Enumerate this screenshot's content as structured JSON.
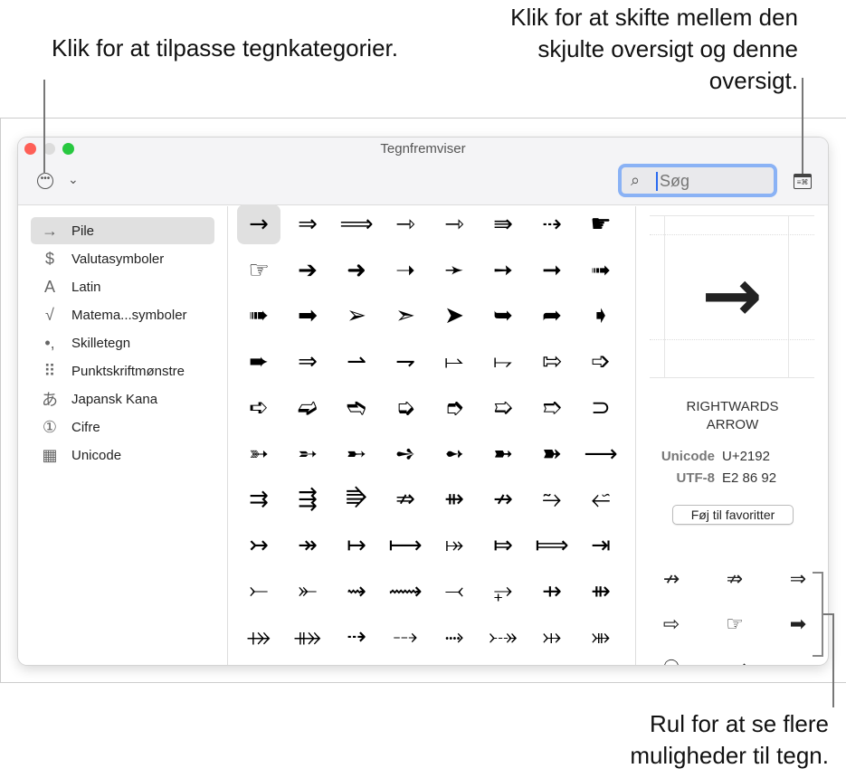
{
  "callouts": {
    "customize": "Klik for at tilpasse tegnkategorier.",
    "toggle": "Klik for at skifte mellem den skjulte oversigt og denne oversigt.",
    "scroll": "Rul for at se flere muligheder til tegn."
  },
  "window": {
    "title": "Tegnfremviser"
  },
  "toolbar": {
    "search_placeholder": "Søg",
    "search_value": ""
  },
  "sidebar": {
    "items": [
      {
        "icon": "→",
        "label": "Pile"
      },
      {
        "icon": "$",
        "label": "Valutasymboler"
      },
      {
        "icon": "A",
        "label": "Latin"
      },
      {
        "icon": "√",
        "label": "Matema...symboler"
      },
      {
        "icon": "•,",
        "label": "Skilletegn"
      },
      {
        "icon": "⠿",
        "label": "Punktskriftmønstre"
      },
      {
        "icon": "あ",
        "label": "Japansk Kana"
      },
      {
        "icon": "①",
        "label": "Cifre"
      },
      {
        "icon": "▦",
        "label": "Unicode"
      }
    ]
  },
  "grid": {
    "rows": [
      [
        "→",
        "⇒",
        "⟹",
        "⇾",
        "⇾",
        "⇛",
        "⇢",
        "☛"
      ],
      [
        "☞",
        "➔",
        "➜",
        "➝",
        "➛",
        "➙",
        "➞",
        "➟"
      ],
      [
        "➠",
        "➡",
        "➢",
        "➣",
        "➤",
        "➥",
        "➦",
        "➧"
      ],
      [
        "➨",
        "⇒",
        "⇀",
        "⇁",
        "⥛",
        "⥟",
        "⇰",
        "➩"
      ],
      [
        "➪",
        "➫",
        "➬",
        "➭",
        "➮",
        "➯",
        "➱",
        "⊃"
      ],
      [
        "➳",
        "➵",
        "➸",
        "➺",
        "➻",
        "➼",
        "➽",
        "⟶"
      ],
      [
        "⇉",
        "⇶",
        "⭆",
        "⇏",
        "⇻",
        "↛",
        "⥲",
        "⭁"
      ],
      [
        "↣",
        "↠",
        "↦",
        "⟼",
        "⤅",
        "⤇",
        "⟾",
        "⇥"
      ],
      [
        "⤚",
        "⤜",
        "⇝",
        "⟿",
        "⤙",
        "⥅",
        "⇸",
        "⇻"
      ],
      [
        "⤀",
        "⤁",
        "⇢",
        "⤏",
        "⤑",
        "⤐",
        "⤔",
        "⤕"
      ]
    ]
  },
  "detail": {
    "glyph": "→",
    "name": "RIGHTWARDS ARROW",
    "unicode_label": "Unicode",
    "unicode_value": "U+2192",
    "utf8_label": "UTF-8",
    "utf8_value": "E2 86 92",
    "favorite_button": "Føj til favoritter",
    "related": [
      "↛",
      "⇏",
      "⇒",
      "⇨",
      "☞",
      "➡",
      "☉",
      "⟶"
    ]
  }
}
